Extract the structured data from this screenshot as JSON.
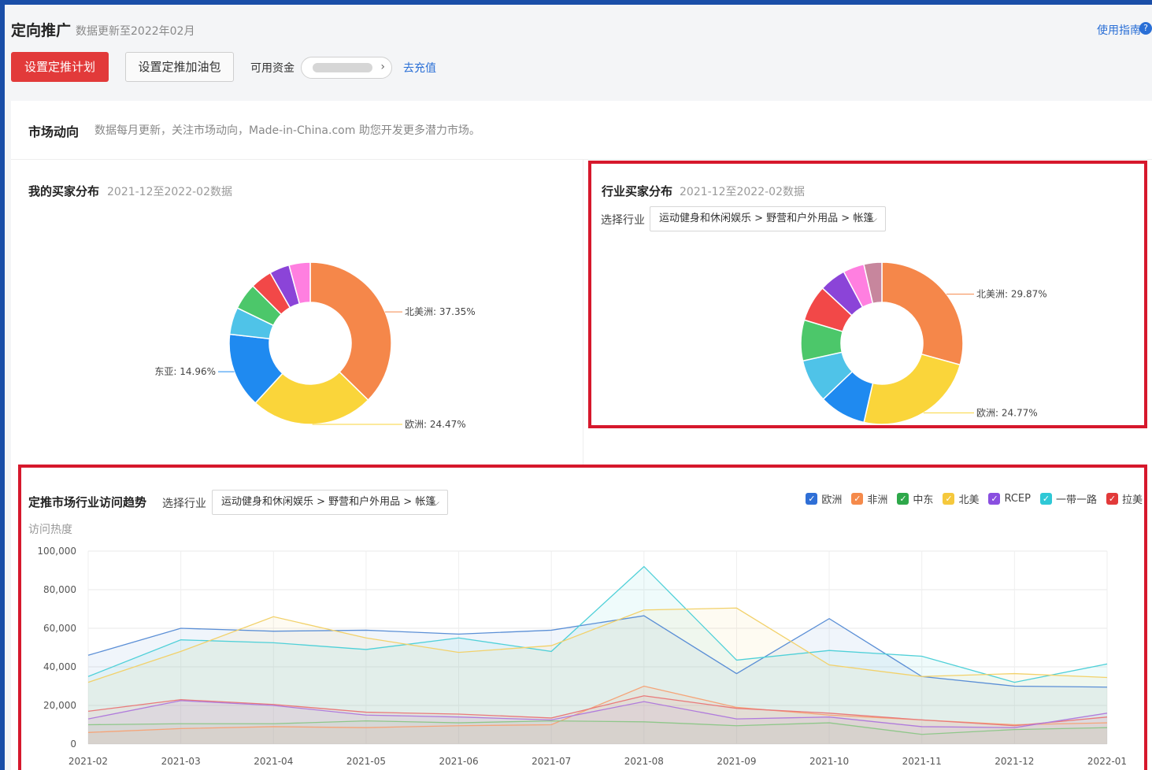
{
  "header": {
    "title": "定向推广",
    "subtitle": "数据更新至2022年02月",
    "guide_link": "使用指南",
    "guide_icon": "?",
    "set_plan_button": "设置定推计划",
    "set_boost_button": "设置定推加油包",
    "funds_label": "可用资金",
    "recharge_link": "去充值"
  },
  "market": {
    "title": "市场动向",
    "description": "数据每月更新，关注市场动向，Made-in-China.com 助您开发更多潜力市场。"
  },
  "my_buyers": {
    "title": "我的买家分布",
    "subtitle": "2021-12至2022-02数据"
  },
  "industry_buyers": {
    "title": "行业买家分布",
    "subtitle": "2021-12至2022-02数据",
    "select_label": "选择行业",
    "select_value": "运动健身和休闲娱乐 > 野营和户外用品 > 帐篷"
  },
  "trend": {
    "title": "定推市场行业访问趋势",
    "select_label": "选择行业",
    "select_value": "运动健身和休闲娱乐 > 野营和户外用品 > 帐篷",
    "y_title": "访问热度",
    "legend": [
      {
        "name": "欧洲",
        "color": "#2f6fd6"
      },
      {
        "name": "非洲",
        "color": "#f58a4b"
      },
      {
        "name": "中东",
        "color": "#2ea84a"
      },
      {
        "name": "北美",
        "color": "#f5c83c"
      },
      {
        "name": "RCEP",
        "color": "#8a4fe0"
      },
      {
        "name": "一带一路",
        "color": "#2fc8d6"
      },
      {
        "name": "拉美",
        "color": "#e23a3a"
      }
    ]
  },
  "chart_data": [
    {
      "type": "pie",
      "title": "我的买家分布",
      "donut": true,
      "slices": [
        {
          "label": "北美洲",
          "value": 37.35,
          "color": "#f5874a",
          "shown_label": "北美洲: 37.35%"
        },
        {
          "label": "欧洲",
          "value": 24.47,
          "color": "#fad53a",
          "shown_label": "欧洲: 24.47%"
        },
        {
          "label": "东亚",
          "value": 14.96,
          "color": "#1f8af0",
          "shown_label": "东亚: 14.96%"
        },
        {
          "label": "",
          "value": 5.4,
          "color": "#4fc3e8"
        },
        {
          "label": "",
          "value": 5.3,
          "color": "#4cc76a"
        },
        {
          "label": "",
          "value": 4.3,
          "color": "#f24848"
        },
        {
          "label": "",
          "value": 4.0,
          "color": "#8b44d8"
        },
        {
          "label": "",
          "value": 4.22,
          "color": "#ff7fe0"
        }
      ]
    },
    {
      "type": "pie",
      "title": "行业买家分布",
      "donut": true,
      "slices": [
        {
          "label": "北美洲",
          "value": 29.87,
          "color": "#f5874a",
          "shown_label": "北美洲: 29.87%"
        },
        {
          "label": "欧洲",
          "value": 24.77,
          "color": "#fad53a",
          "shown_label": "欧洲: 24.77%"
        },
        {
          "label": "",
          "value": 9.5,
          "color": "#1f8af0"
        },
        {
          "label": "",
          "value": 8.8,
          "color": "#4fc3e8"
        },
        {
          "label": "",
          "value": 8.3,
          "color": "#4cc76a"
        },
        {
          "label": "",
          "value": 7.4,
          "color": "#f24848"
        },
        {
          "label": "",
          "value": 5.4,
          "color": "#8b44d8"
        },
        {
          "label": "",
          "value": 4.3,
          "color": "#ff7fe0"
        },
        {
          "label": "",
          "value": 3.66,
          "color": "#c7869d"
        }
      ]
    },
    {
      "type": "area",
      "title": "定推市场行业访问趋势",
      "ylabel": "访问热度",
      "ylim": [
        0,
        100000
      ],
      "yticks": [
        "0",
        "20,000",
        "40,000",
        "60,000",
        "80,000",
        "100,000"
      ],
      "categories": [
        "2021-02",
        "2021-03",
        "2021-04",
        "2021-05",
        "2021-06",
        "2021-07",
        "2021-08",
        "2021-09",
        "2021-10",
        "2021-11",
        "2021-12",
        "2022-01"
      ],
      "series": [
        {
          "name": "欧洲",
          "color": "#5b8fd6",
          "values": [
            46000,
            60000,
            58500,
            59000,
            57000,
            59000,
            66500,
            36500,
            65000,
            35000,
            30000,
            29500
          ]
        },
        {
          "name": "一带一路",
          "color": "#4fd0d8",
          "values": [
            35000,
            54000,
            52500,
            49000,
            55000,
            48000,
            92000,
            43500,
            48500,
            45500,
            32000,
            41500
          ]
        },
        {
          "name": "北美",
          "color": "#f2d16a",
          "values": [
            32000,
            48000,
            66000,
            55000,
            47500,
            51000,
            69500,
            70500,
            41000,
            35000,
            36500,
            34500
          ]
        },
        {
          "name": "非洲",
          "color": "#f5a478",
          "values": [
            6000,
            8000,
            9000,
            8500,
            9500,
            10000,
            30000,
            19000,
            15000,
            12500,
            10000,
            11000
          ]
        },
        {
          "name": "拉美",
          "color": "#e97a7a",
          "values": [
            17000,
            23000,
            20500,
            16500,
            15500,
            13500,
            25000,
            18500,
            16000,
            12500,
            9500,
            14000
          ]
        },
        {
          "name": "RCEP",
          "color": "#b07bdc",
          "values": [
            13000,
            22500,
            20000,
            15000,
            14000,
            12500,
            22000,
            13000,
            14000,
            9000,
            8500,
            16000
          ]
        },
        {
          "name": "中东",
          "color": "#8fc78a",
          "values": [
            10000,
            10500,
            10500,
            12000,
            11000,
            12000,
            11500,
            9500,
            11000,
            5000,
            7500,
            8500
          ]
        }
      ]
    }
  ]
}
